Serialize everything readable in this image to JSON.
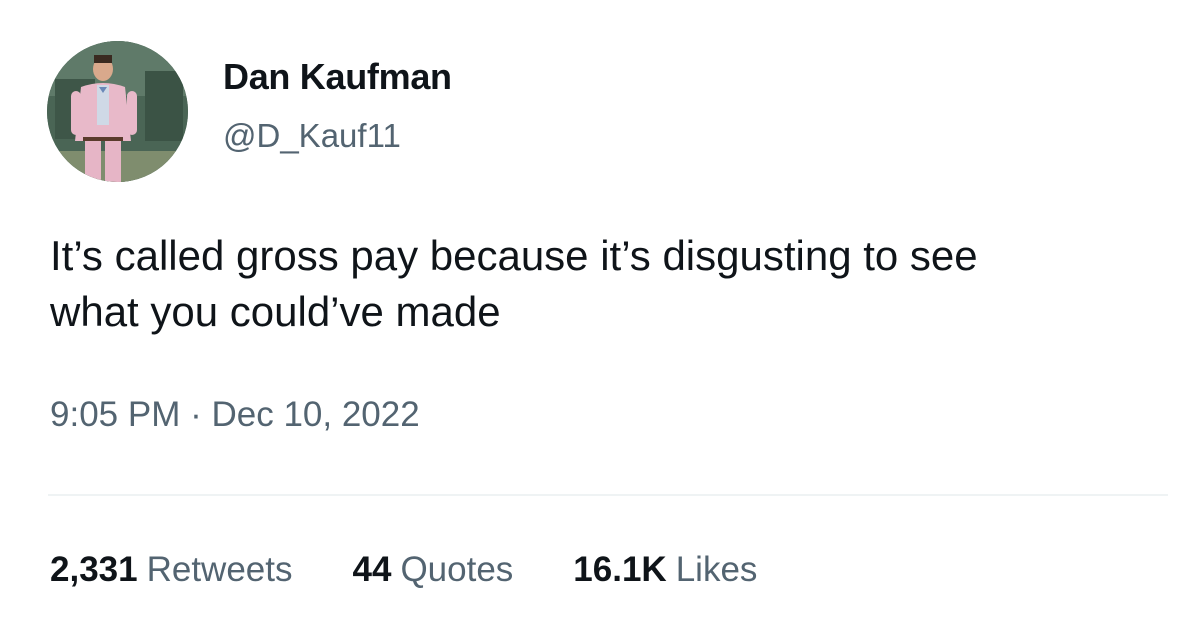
{
  "author": {
    "display_name": "Dan Kaufman",
    "handle": "@D_Kauf11",
    "avatar_icon": "profile-photo"
  },
  "tweet": {
    "text_lines": [
      "It’s called gross pay because it’s disgusting to see",
      "what you could’ve made"
    ],
    "time": "9:05 PM",
    "separator": "·",
    "date": "Dec 10, 2022"
  },
  "stats": {
    "retweets": {
      "count": "2,331",
      "label": "Retweets"
    },
    "quotes": {
      "count": "44",
      "label": "Quotes"
    },
    "likes": {
      "count": "16.1K",
      "label": "Likes"
    }
  },
  "colors": {
    "primary_text": "#0f1419",
    "secondary_text": "#536471",
    "divider": "#eff3f4"
  }
}
